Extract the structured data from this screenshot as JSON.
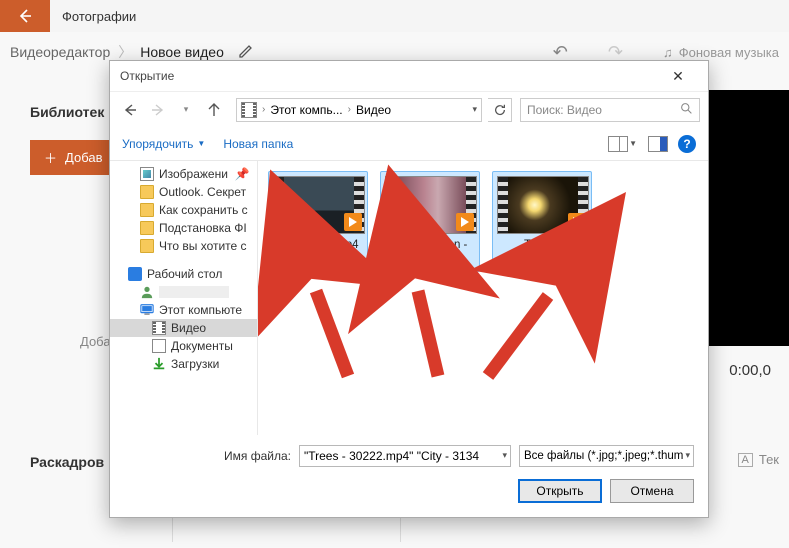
{
  "app": {
    "title": "Фотографии",
    "breadcrumb": {
      "root": "Видеоредактор",
      "current": "Новое видео"
    },
    "undo_icon": "↶",
    "redo_icon": "↷",
    "music_label": "Фоновая музыка"
  },
  "library": {
    "title": "Библиотек",
    "add_label": "Добав",
    "add_placeholder": "Доба",
    "storyboard_title": "Раскадров"
  },
  "preview": {
    "timecode": "0:00,0"
  },
  "text_tool": {
    "label": "Тек",
    "icon": "A"
  },
  "dialog": {
    "title": "Открытие",
    "path": {
      "root": "Этот компь...",
      "folder": "Видео"
    },
    "search_placeholder": "Поиск: Видео",
    "organize_label": "Упорядочить",
    "newfolder_label": "Новая папка",
    "tree": {
      "images": "Изображени",
      "outlook": "Outlook. Секрет",
      "howto": "Как сохранить с",
      "prep": "Подстановка ФI",
      "whatyou": "Что вы хотите с",
      "desktop": "Рабочий стол",
      "user": " ",
      "thispc": "Этот компьюте",
      "video": "Видео",
      "documents": "Документы",
      "downloads": "Загрузки"
    },
    "files": [
      {
        "name": "City - 3134.mp4"
      },
      {
        "name": "Conversation - 180.mp4"
      },
      {
        "name": "Trees - 30222.mp4"
      }
    ],
    "filename_label": "Имя файла:",
    "filename_value": "\"Trees - 30222.mp4\" \"City - 3134",
    "filter_value": "Все файлы (*.jpg;*.jpeg;*.thum",
    "open_label": "Открыть",
    "cancel_label": "Отмена"
  }
}
